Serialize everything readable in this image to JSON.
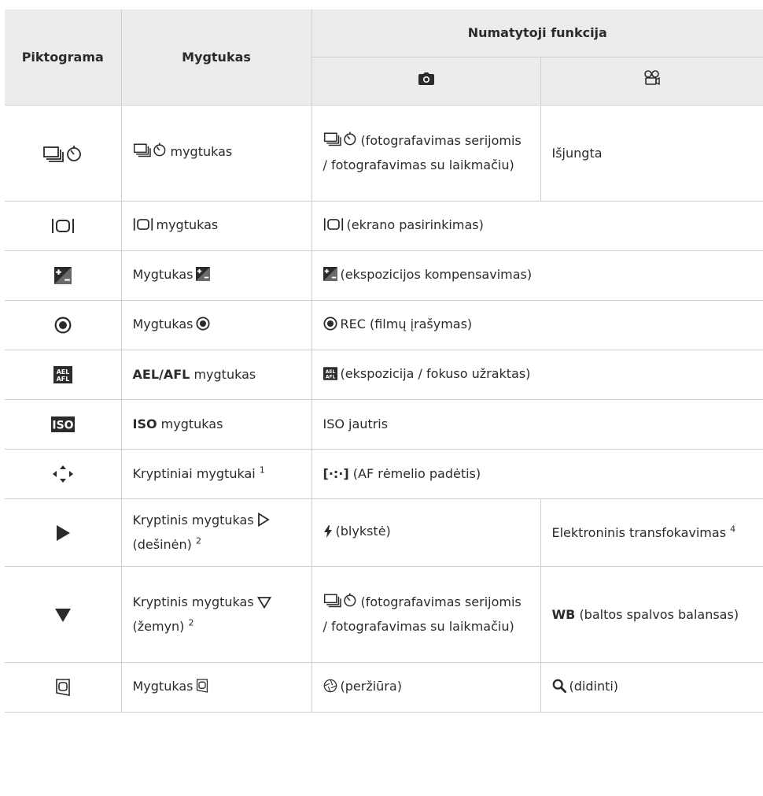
{
  "header": {
    "col_icon": "Piktograma",
    "col_button": "Mygtukas",
    "col_function": "Numatytoji funkcija",
    "photo_icon": "camera-icon",
    "movie_icon": "movie-camera-icon"
  },
  "rows": [
    {
      "icon": "drive-self-timer-icon",
      "button_text": "mygtukas",
      "photo_text": "(fotografavimas serijomis / fotografavimas su laikmačiu)",
      "movie_text": "Išjungta"
    },
    {
      "icon": "display-select-icon",
      "button_text": "mygtukas",
      "photo_text": "(ekrano pasirinkimas)"
    },
    {
      "icon": "exposure-compensation-icon",
      "button_text": "Mygtukas",
      "photo_text": "(ekspozicijos kompensavimas)"
    },
    {
      "icon": "rec-icon",
      "button_text": "Mygtukas",
      "photo_text": "REC (filmų įrašymas)"
    },
    {
      "icon": "ael-afl-icon",
      "button_bold": "AEL/AFL",
      "button_text": "mygtukas",
      "photo_text": "(ekspozicija / fokuso užraktas)"
    },
    {
      "icon": "iso-icon",
      "button_bold": "ISO",
      "button_text": "mygtukas",
      "photo_text": "ISO jautris"
    },
    {
      "icon": "arrow-pad-icon",
      "button_text": "Kryptiniai mygtukai",
      "button_sup": "1",
      "photo_bold": "[·:·]",
      "photo_text": "(AF rėmelio padėtis)"
    },
    {
      "icon": "play-right-icon",
      "button_text": "Kryptinis mygtukas",
      "button_text2": "(dešinėn)",
      "button_sup": "2",
      "photo_text": "(blykstė)",
      "movie_text": "Elektroninis transfokavimas",
      "movie_sup": "4"
    },
    {
      "icon": "triangle-down-icon",
      "button_text": "Kryptinis mygtukas",
      "button_text2": "(žemyn)",
      "button_sup": "2",
      "photo_text": "(fotografavimas serijomis / fotografavimas su laikmačiu)",
      "movie_bold": "WB",
      "movie_text": "(baltos spalvos balansas)"
    },
    {
      "icon": "preview-icon",
      "button_text": "Mygtukas",
      "photo_text": "(peržiūra)",
      "movie_text": "(didinti)"
    }
  ],
  "colors": {
    "header_bg": "#ececec",
    "border": "#cfcfcf",
    "text": "#2b2b2b"
  }
}
